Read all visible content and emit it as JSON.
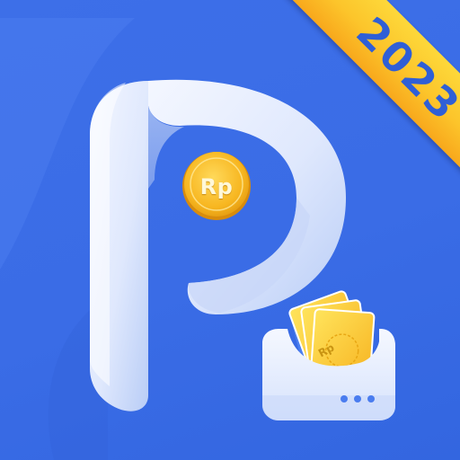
{
  "app_icon": {
    "ribbon_year": "2023",
    "coin_currency": "Rp",
    "banknote_currency": "Rp",
    "colors": {
      "background": "#3d6fe8",
      "ribbon": "#fcc52b",
      "ribbon_text": "#2f5fd6",
      "logo_letter": "#e8efff",
      "coin": "#f5b21e",
      "wallet": "#e9f0ff"
    },
    "icons": [
      "letter-p-logo",
      "gold-coin-icon",
      "wallet-with-banknotes-icon"
    ]
  }
}
